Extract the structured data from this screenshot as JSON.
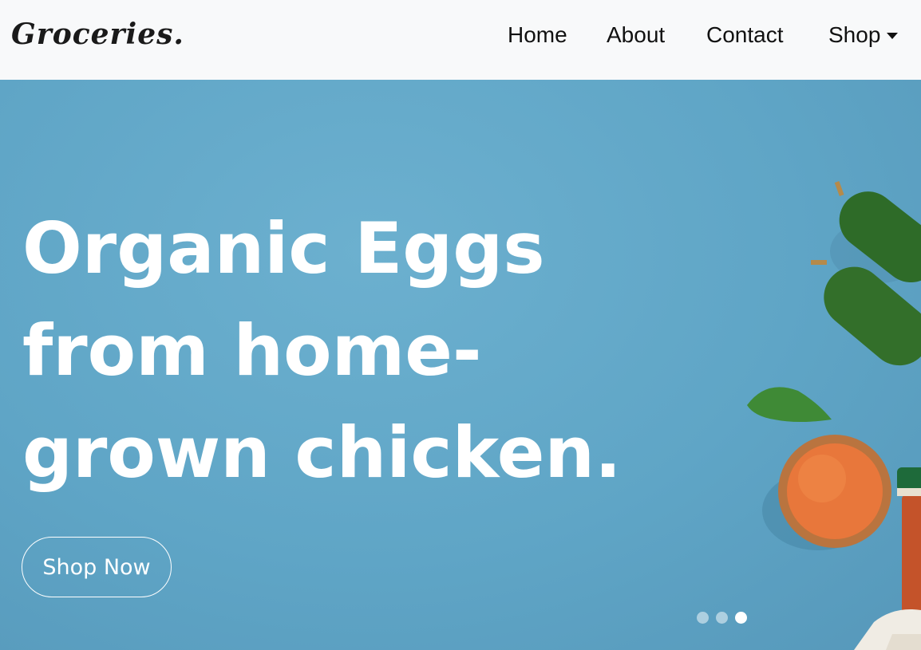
{
  "brand": {
    "name": "Groceries."
  },
  "nav": {
    "items": [
      {
        "label": "Home"
      },
      {
        "label": "About"
      },
      {
        "label": "Contact"
      },
      {
        "label": "Shop"
      }
    ]
  },
  "hero": {
    "headline_lines": [
      "Organic Eggs",
      "from home-",
      "grown chicken."
    ],
    "cta_label": "Shop Now",
    "slides_total": 3,
    "active_slide": 3
  },
  "colors": {
    "navbar_bg": "#f8f9fa",
    "hero_bg": "#5fa5c6",
    "text_white": "#ffffff",
    "nav_text": "#111111"
  }
}
